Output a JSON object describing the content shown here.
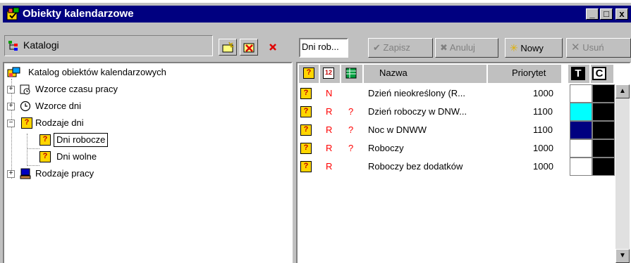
{
  "window": {
    "title": "Obiekty kalendarzowe",
    "minimize": "_",
    "maximize": "□",
    "close": "x"
  },
  "left_pane": {
    "label": "Katalogi"
  },
  "toolbar": {
    "name_field": "Dni rob...",
    "save_label": "Zapisz",
    "cancel_label": "Anuluj",
    "new_label": "Nowy",
    "delete_label": "Usuń"
  },
  "tree": {
    "root": "Katalog obiektów kalendarzowych",
    "items": [
      {
        "label": "Wzorce czasu pracy",
        "expander": "+"
      },
      {
        "label": "Wzorce dni",
        "expander": "+"
      },
      {
        "label": "Rodzaje dni",
        "expander": "−"
      },
      {
        "label": "Dni robocze"
      },
      {
        "label": "Dni wolne"
      },
      {
        "label": "Rodzaje pracy",
        "expander": "+"
      }
    ]
  },
  "list": {
    "columns": {
      "icon1": "?",
      "icon2": "12",
      "name": "Nazwa",
      "priority": "Priorytet",
      "t": "T",
      "c": "C"
    },
    "rows": [
      {
        "type": "N",
        "flag": "",
        "name": "Dzień nieokreślony (R...",
        "priority": "1000",
        "color1": "#ffffff",
        "color2": "#000000"
      },
      {
        "type": "R",
        "flag": "?",
        "name": "Dzień roboczy w DNW...",
        "priority": "1100",
        "color1": "#00ffff",
        "color2": "#000000"
      },
      {
        "type": "R",
        "flag": "?",
        "name": "Noc w DNWW",
        "priority": "1100",
        "color1": "#000080",
        "color2": "#000000"
      },
      {
        "type": "R",
        "flag": "?",
        "name": "Roboczy",
        "priority": "1000",
        "color1": "#ffffff",
        "color2": "#000000"
      },
      {
        "type": "R",
        "flag": "",
        "name": "Roboczy bez dodatków",
        "priority": "1000",
        "color1": "#ffffff",
        "color2": "#000000"
      }
    ],
    "cal_icon": "?"
  },
  "colors": {
    "titlebar": "#000080",
    "type_letter": "#ff0000",
    "face": "#c0c0c0"
  }
}
